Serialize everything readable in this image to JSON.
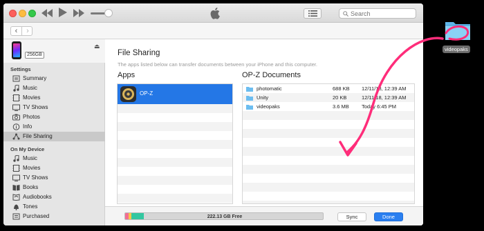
{
  "window": {
    "search_placeholder": "Search",
    "colors": {
      "accent": "#2477e6",
      "annotation": "#ff2d7a"
    }
  },
  "toolbar": {
    "icons": [
      "rewind-icon",
      "play-icon",
      "fast-forward-icon",
      "volume-slider",
      "apple-icon",
      "list-view-icon",
      "search-icon"
    ],
    "nav_back": "‹",
    "nav_forward": "›"
  },
  "device": {
    "capacity": "256GB"
  },
  "sidebar": {
    "settings_title": "Settings",
    "settings_items": [
      {
        "label": "Summary",
        "icon": "summary-icon"
      },
      {
        "label": "Music",
        "icon": "music-note-icon"
      },
      {
        "label": "Movies",
        "icon": "film-icon"
      },
      {
        "label": "TV Shows",
        "icon": "tv-icon"
      },
      {
        "label": "Photos",
        "icon": "camera-icon"
      },
      {
        "label": "Info",
        "icon": "info-icon"
      },
      {
        "label": "File Sharing",
        "icon": "file-sharing-icon",
        "selected": true
      }
    ],
    "device_title": "On My Device",
    "device_items": [
      {
        "label": "Music",
        "icon": "music-note-icon"
      },
      {
        "label": "Movies",
        "icon": "film-icon"
      },
      {
        "label": "TV Shows",
        "icon": "tv-icon"
      },
      {
        "label": "Books",
        "icon": "book-icon"
      },
      {
        "label": "Audiobooks",
        "icon": "audiobook-icon"
      },
      {
        "label": "Tones",
        "icon": "bell-icon"
      },
      {
        "label": "Purchased",
        "icon": "purchased-list-icon"
      }
    ]
  },
  "main": {
    "title": "File Sharing",
    "description": "The apps listed below can transfer documents between your iPhone and this computer.",
    "apps_header": "Apps",
    "apps": [
      {
        "name": "OP-Z",
        "selected": true
      }
    ],
    "docs_header": "OP-Z Documents",
    "documents": [
      {
        "name": "photomatic",
        "size": "688 KB",
        "date": "12/11/18, 12:39 AM"
      },
      {
        "name": "Unity",
        "size": "20 KB",
        "date": "12/11/18, 12:39 AM"
      },
      {
        "name": "videopaks",
        "size": "3.6 MB",
        "date": "Today 6:45 PM"
      }
    ]
  },
  "footer": {
    "free_space": "222.13 GB Free",
    "sync_label": "Sync",
    "done_label": "Done",
    "storage_segments": [
      {
        "name": "pink",
        "color": "#f26e93"
      },
      {
        "name": "yellow",
        "color": "#f7c948"
      },
      {
        "name": "teal",
        "color": "#33c7a0"
      }
    ]
  },
  "desktop": {
    "folder_label": "videopaks"
  }
}
